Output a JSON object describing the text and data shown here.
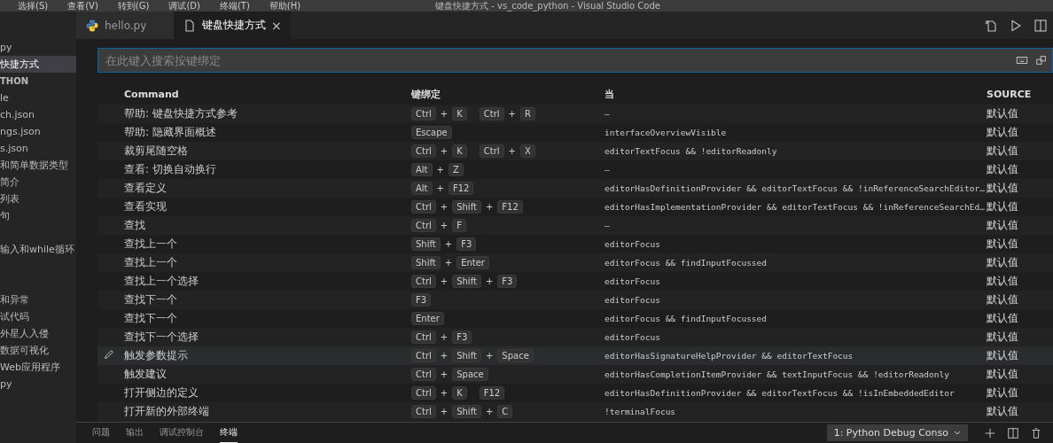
{
  "menu_bar": {
    "items": [
      "选择(S)",
      "查看(V)",
      "转到(G)",
      "调试(D)",
      "终端(T)",
      "帮助(H)"
    ],
    "title": "键盘快捷方式 - vs_code_python - Visual Studio Code"
  },
  "sidebar": {
    "items": [
      {
        "label": "py",
        "kind": "file",
        "selected": false
      },
      {
        "label": "快捷方式",
        "kind": "file",
        "selected": true
      },
      {
        "label": "THON",
        "kind": "header"
      },
      {
        "label": "le",
        "kind": "file",
        "selected": false
      },
      {
        "label": "ch.json",
        "kind": "file",
        "selected": false
      },
      {
        "label": "ngs.json",
        "kind": "file",
        "selected": false
      },
      {
        "label": "s.json",
        "kind": "file",
        "selected": false
      },
      {
        "label": "和简单数据类型",
        "kind": "file",
        "selected": false
      },
      {
        "label": "简介",
        "kind": "file",
        "selected": false
      },
      {
        "label": "列表",
        "kind": "file",
        "selected": false
      },
      {
        "label": "句",
        "kind": "file",
        "selected": false
      },
      {
        "kind": "blank"
      },
      {
        "label": "输入和while循环",
        "kind": "file",
        "selected": false
      },
      {
        "kind": "blank"
      },
      {
        "kind": "blank"
      },
      {
        "label": "和异常",
        "kind": "file",
        "selected": false
      },
      {
        "label": "试代码",
        "kind": "file",
        "selected": false
      },
      {
        "label": "外星人入侵",
        "kind": "file",
        "selected": false
      },
      {
        "label": "数据可视化",
        "kind": "file",
        "selected": false
      },
      {
        "label": "Web应用程序",
        "kind": "file",
        "selected": false
      },
      {
        "label": "py",
        "kind": "file",
        "selected": false
      }
    ]
  },
  "tabs": [
    {
      "label": "hello.py",
      "kind": "python",
      "selected": false
    },
    {
      "label": "键盘快捷方式",
      "kind": "file",
      "selected": true,
      "close": "×"
    }
  ],
  "search": {
    "placeholder": "在此键入搜索按键绑定"
  },
  "table": {
    "columns": [
      "Command",
      "键绑定",
      "当",
      "SOURCE"
    ],
    "key_joiner": "+",
    "rows": [
      {
        "command": "帮助: 键盘快捷方式参考",
        "keys": [
          [
            "Ctrl",
            "K"
          ],
          [
            "Ctrl",
            "R"
          ]
        ],
        "when": "—",
        "source": "默认值",
        "selected": false
      },
      {
        "command": "帮助: 隐藏界面概述",
        "keys": [
          [
            "Escape"
          ]
        ],
        "when": "interfaceOverviewVisible",
        "source": "默认值",
        "selected": false
      },
      {
        "command": "裁剪尾随空格",
        "keys": [
          [
            "Ctrl",
            "K"
          ],
          [
            "Ctrl",
            "X"
          ]
        ],
        "when": "editorTextFocus && !editorReadonly",
        "source": "默认值",
        "selected": false
      },
      {
        "command": "查看: 切换自动换行",
        "keys": [
          [
            "Alt",
            "Z"
          ]
        ],
        "when": "—",
        "source": "默认值",
        "selected": false
      },
      {
        "command": "查看定义",
        "keys": [
          [
            "Alt",
            "F12"
          ]
        ],
        "when": "editorHasDefinitionProvider && editorTextFocus && !inReferenceSearchEditor…",
        "source": "默认值",
        "selected": false
      },
      {
        "command": "查看实现",
        "keys": [
          [
            "Ctrl",
            "Shift",
            "F12"
          ]
        ],
        "when": "editorHasImplementationProvider && editorTextFocus && !inReferenceSearchEd…",
        "source": "默认值",
        "selected": false
      },
      {
        "command": "查找",
        "keys": [
          [
            "Ctrl",
            "F"
          ]
        ],
        "when": "—",
        "source": "默认值",
        "selected": false
      },
      {
        "command": "查找上一个",
        "keys": [
          [
            "Shift",
            "F3"
          ]
        ],
        "when": "editorFocus",
        "source": "默认值",
        "selected": false
      },
      {
        "command": "查找上一个",
        "keys": [
          [
            "Shift",
            "Enter"
          ]
        ],
        "when": "editorFocus && findInputFocussed",
        "source": "默认值",
        "selected": false
      },
      {
        "command": "查找上一个选择",
        "keys": [
          [
            "Ctrl",
            "Shift",
            "F3"
          ]
        ],
        "when": "editorFocus",
        "source": "默认值",
        "selected": false
      },
      {
        "command": "查找下一个",
        "keys": [
          [
            "F3"
          ]
        ],
        "when": "editorFocus",
        "source": "默认值",
        "selected": false
      },
      {
        "command": "查找下一个",
        "keys": [
          [
            "Enter"
          ]
        ],
        "when": "editorFocus && findInputFocussed",
        "source": "默认值",
        "selected": false
      },
      {
        "command": "查找下一个选择",
        "keys": [
          [
            "Ctrl",
            "F3"
          ]
        ],
        "when": "editorFocus",
        "source": "默认值",
        "selected": false
      },
      {
        "command": "触发参数提示",
        "keys": [
          [
            "Ctrl",
            "Shift",
            "Space"
          ]
        ],
        "when": "editorHasSignatureHelpProvider && editorTextFocus",
        "source": "默认值",
        "selected": true
      },
      {
        "command": "触发建议",
        "keys": [
          [
            "Ctrl",
            "Space"
          ]
        ],
        "when": "editorHasCompletionItemProvider && textInputFocus && !editorReadonly",
        "source": "默认值",
        "selected": false
      },
      {
        "command": "打开侧边的定义",
        "keys": [
          [
            "Ctrl",
            "K"
          ],
          [
            "F12"
          ]
        ],
        "when": "editorHasDefinitionProvider && editorTextFocus && !isInEmbeddedEditor",
        "source": "默认值",
        "selected": false
      },
      {
        "command": "打开新的外部终端",
        "keys": [
          [
            "Ctrl",
            "Shift",
            "C"
          ]
        ],
        "when": "!terminalFocus",
        "source": "默认值",
        "selected": false
      }
    ]
  },
  "panel": {
    "tabs": [
      {
        "label": "问题",
        "selected": false
      },
      {
        "label": "输出",
        "selected": false
      },
      {
        "label": "调试控制台",
        "selected": false
      },
      {
        "label": "终端",
        "selected": true
      }
    ],
    "terminal_select": "1: Python Debug Conso"
  }
}
